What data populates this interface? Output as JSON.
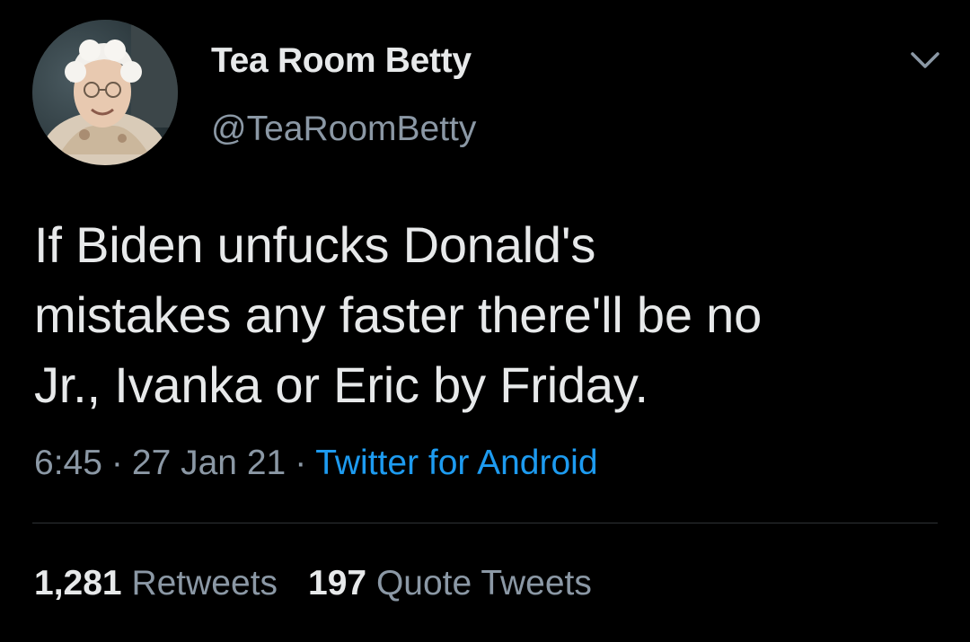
{
  "author": {
    "display_name": "Tea Room Betty",
    "handle": "@TeaRoomBetty"
  },
  "tweet": {
    "lines": [
      "If Biden unfucks Donald's",
      "mistakes any faster there'll be no",
      "Jr., Ivanka or Eric by Friday."
    ],
    "time": "6:45",
    "date": "27 Jan 21",
    "separator": "·",
    "source": "Twitter for Android"
  },
  "stats": {
    "retweets_count": "1,281",
    "retweets_label": "Retweets",
    "quotes_count": "197",
    "quotes_label": "Quote Tweets"
  },
  "icons": {
    "more": "chevron-down-icon",
    "avatar": "profile-photo"
  },
  "colors": {
    "background": "#000000",
    "text": "#e7e9ea",
    "muted": "#8b98a5",
    "link": "#1d9bf0",
    "divider": "#2f3336"
  }
}
